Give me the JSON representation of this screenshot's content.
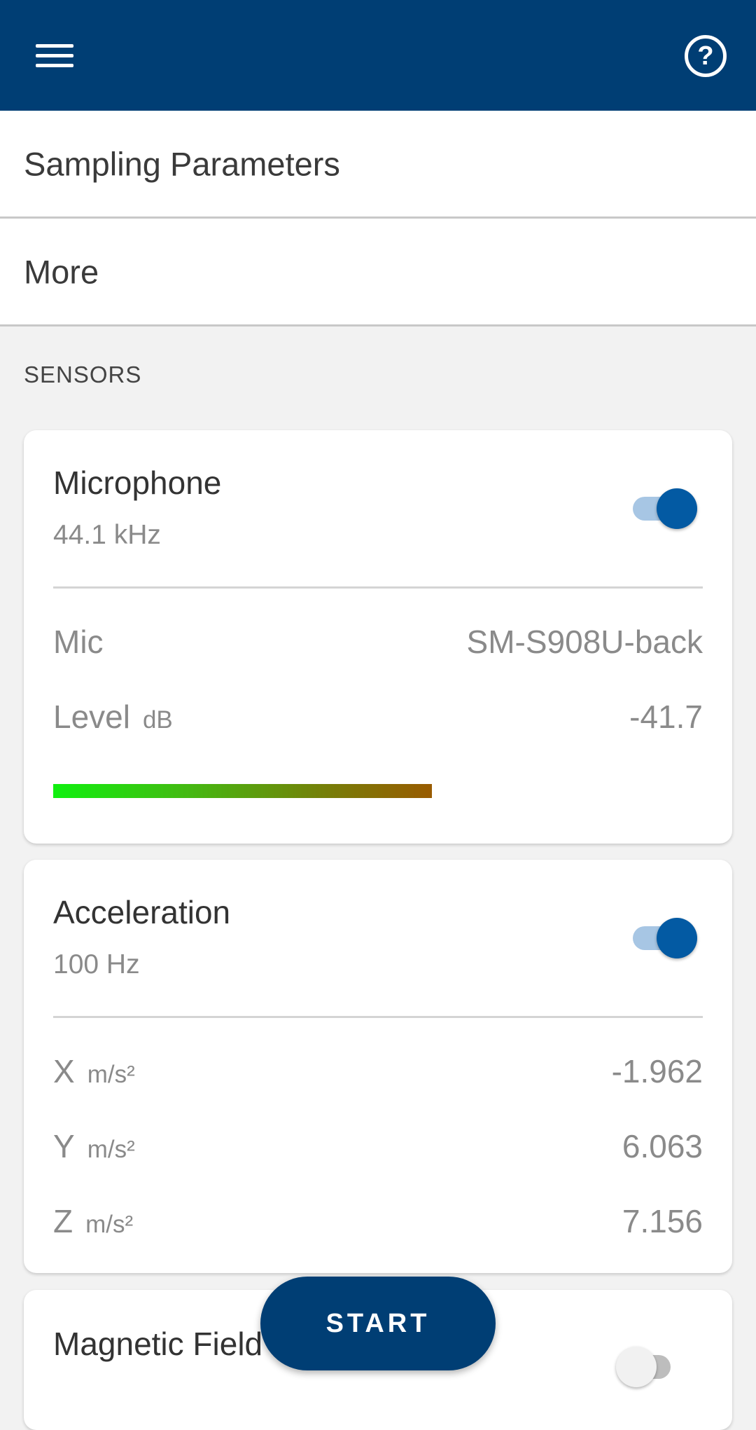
{
  "appbar": {
    "menu_icon": "hamburger-menu-icon",
    "help_icon": "question-circle-icon",
    "help_glyph": "?"
  },
  "rows": {
    "sampling": "Sampling Parameters",
    "more": "More"
  },
  "sensors_label": "SENSORS",
  "microphone": {
    "title": "Microphone",
    "rate": "44.1 kHz",
    "enabled": true,
    "mic_label": "Mic",
    "mic_value": "SM-S908U-back",
    "level_label": "Level",
    "level_unit": "dB",
    "level_value": "-41.7"
  },
  "acceleration": {
    "title": "Acceleration",
    "rate": "100 Hz",
    "enabled": true,
    "x_label": "X",
    "x_unit": "m/s²",
    "x_value": "-1.962",
    "y_label": "Y",
    "y_unit": "m/s²",
    "y_value": "6.063",
    "z_label": "Z",
    "z_unit": "m/s²",
    "z_value": "7.156"
  },
  "magnetic": {
    "title": "Magnetic Field",
    "enabled": false
  },
  "start_button": "START",
  "colors": {
    "appbar": "#003e74",
    "accent": "#035aa3"
  }
}
